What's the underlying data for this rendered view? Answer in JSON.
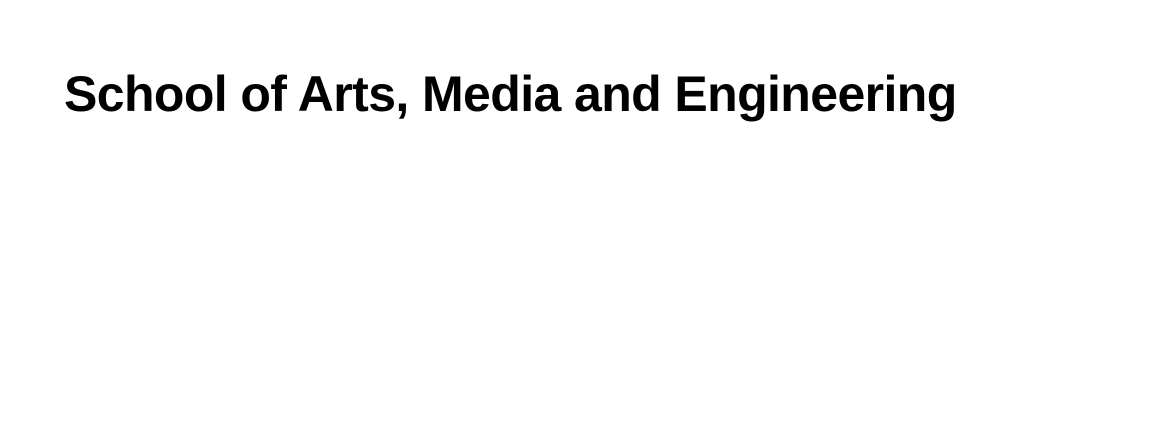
{
  "heading": {
    "title": "School of Arts, Media and Engineering",
    "text_color": "#000000"
  },
  "page": {
    "background_color": "#ffffff"
  }
}
